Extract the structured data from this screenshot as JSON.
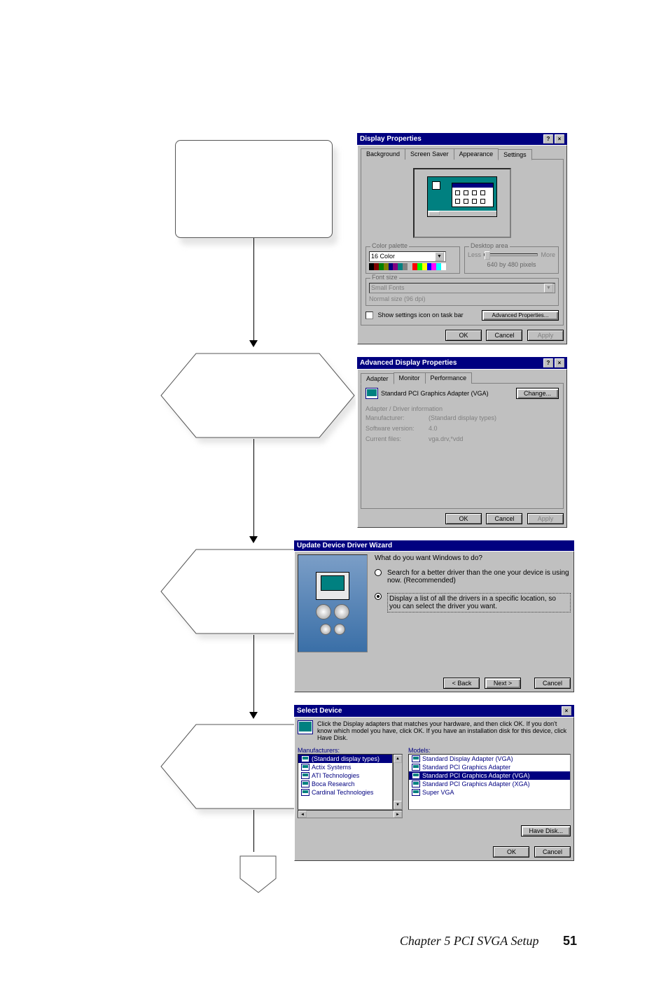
{
  "footer": {
    "chapter": "Chapter 5  PCI SVGA Setup",
    "page": "51"
  },
  "display_props": {
    "title": "Display Properties",
    "tabs": [
      "Background",
      "Screen Saver",
      "Appearance",
      "Settings"
    ],
    "color_group": "Color palette",
    "color_value": "16 Color",
    "desktop_group": "Desktop area",
    "desktop_less": "Less",
    "desktop_more": "More",
    "desktop_value": "640 by 480 pixels",
    "font_group": "Font size",
    "font_value": "Small Fonts",
    "font_note": "Normal size (96 dpi)",
    "show_icon": "Show settings icon on task bar",
    "adv_btn": "Advanced Properties...",
    "ok": "OK",
    "cancel": "Cancel",
    "apply": "Apply"
  },
  "adv_props": {
    "title": "Advanced Display Properties",
    "tabs": [
      "Adapter",
      "Monitor",
      "Performance"
    ],
    "adapter_label": "Standard PCI Graphics Adapter (VGA)",
    "change_btn": "Change...",
    "info_hdr": "Adapter / Driver information",
    "manu_k": "Manufacturer:",
    "manu_v": "(Standard display types)",
    "ver_k": "Software version:",
    "ver_v": "4.0",
    "files_k": "Current files:",
    "files_v": "vga.drv,*vdd",
    "ok": "OK",
    "cancel": "Cancel",
    "apply": "Apply"
  },
  "wizard": {
    "title": "Update Device Driver Wizard",
    "prompt": "What do you want Windows to do?",
    "opt1": "Search for a better driver than the one your device is using now. (Recommended)",
    "opt2": "Display a list of all the drivers in a specific location, so you can select the driver you want.",
    "back": "< Back",
    "next": "Next >",
    "cancel": "Cancel"
  },
  "select_device": {
    "title": "Select Device",
    "instr": "Click the Display adapters that matches your hardware, and then click OK. If you don't know which model you have, click OK. If you have an installation disk for this device, click Have Disk.",
    "manu_hdr": "Manufacturers:",
    "models_hdr": "Models:",
    "manufacturers": [
      "(Standard display types)",
      "Actix Systems",
      "ATI Technologies",
      "Boca Research",
      "Cardinal Technologies"
    ],
    "manu_selected": 0,
    "models": [
      "Standard Display Adapter (VGA)",
      "Standard PCI Graphics Adapter",
      "Standard PCI Graphics Adapter (VGA)",
      "Standard PCI Graphics Adapter (XGA)",
      "Super VGA"
    ],
    "model_selected": 2,
    "have_disk": "Have Disk...",
    "ok": "OK",
    "cancel": "Cancel"
  }
}
